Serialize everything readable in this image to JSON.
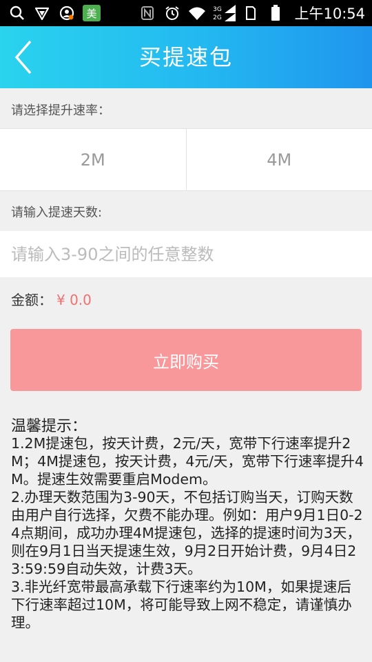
{
  "status_bar": {
    "left_icons": [
      "search-icon",
      "vpn-shield-icon",
      "account-icon",
      "meituan-icon"
    ],
    "meituan_label": "美",
    "right_icons": [
      "nfc-icon",
      "alarm-icon",
      "wifi-icon",
      "signal-3g-icon",
      "signal-2g-icon",
      "sim-icon",
      "battery-icon"
    ],
    "net_top": "3G",
    "net_bottom": "2G",
    "time": "上午10:54"
  },
  "header": {
    "title": "买提速包",
    "back_icon": "chevron-left-icon",
    "gradient": [
      "#2ad3ee",
      "#1f95ee"
    ]
  },
  "speed": {
    "label": "请选择提升速率：",
    "options": [
      "2M",
      "4M"
    ]
  },
  "days": {
    "label": "请输入提速天数:",
    "placeholder": "请输入3-90之间的任意整数",
    "value": ""
  },
  "amount": {
    "label": "金额：",
    "value": "¥ 0.0"
  },
  "buy_button": {
    "label": "立即购买",
    "color": "#f9989a"
  },
  "tips": {
    "title": "温馨提示：",
    "paragraphs": [
      "1.2M提速包，按天计费，2元/天，宽带下行速率提升2M；4M提速包，按天计费，4元/天，宽带下行速率提升4M。提速生效需要重启Modem。",
      "2.办理天数范围为3-90天，不包括订购当天，订购天数由用户自行选择，欠费不能办理。例如：用户9月1日0-24点期间，成功办理4M提速包，选择的提速时间为3天，则在9月1日当天提速生效，9月2日开始计费，9月4日23:59:59自动失效，计费3天。",
      "3.非光纤宽带最高承载下行速率约为10M，如果提速后下行速率超过10M，将可能导致上网不稳定，请谨慎办理。"
    ]
  },
  "accent_color": "#f07070"
}
